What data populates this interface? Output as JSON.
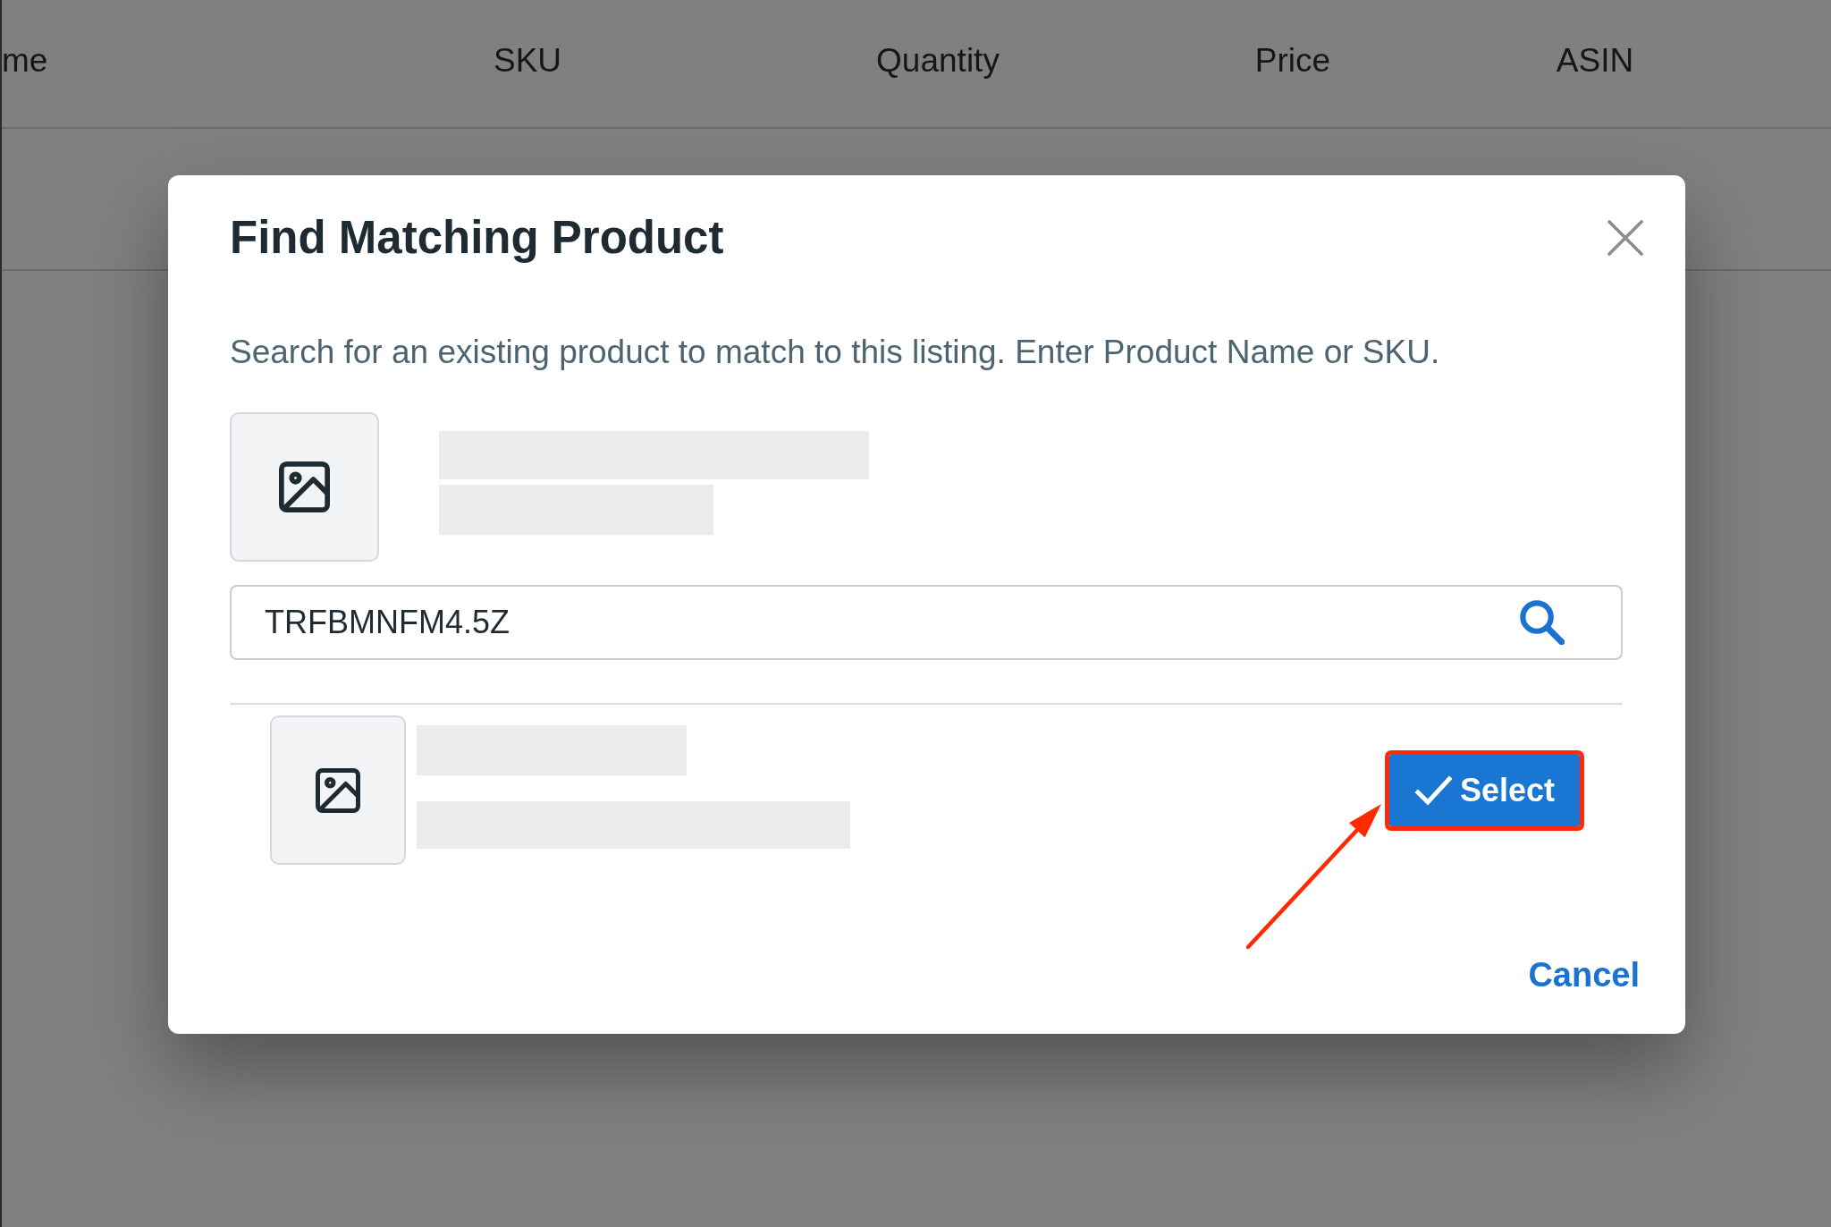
{
  "background_table": {
    "columns": [
      "me",
      "SKU",
      "Quantity",
      "Price",
      "ASIN"
    ]
  },
  "dialog": {
    "title": "Find Matching Product",
    "description": "Search for an existing product to match to this listing. Enter Product Name or SKU.",
    "listing_preview": {
      "loading": true
    },
    "search": {
      "value": "TRFBMNFM4.5Z"
    },
    "results": [
      {
        "loading": true,
        "select_button": {
          "label": "Select",
          "highlighted": true
        }
      }
    ],
    "cancel_button": "Cancel"
  }
}
